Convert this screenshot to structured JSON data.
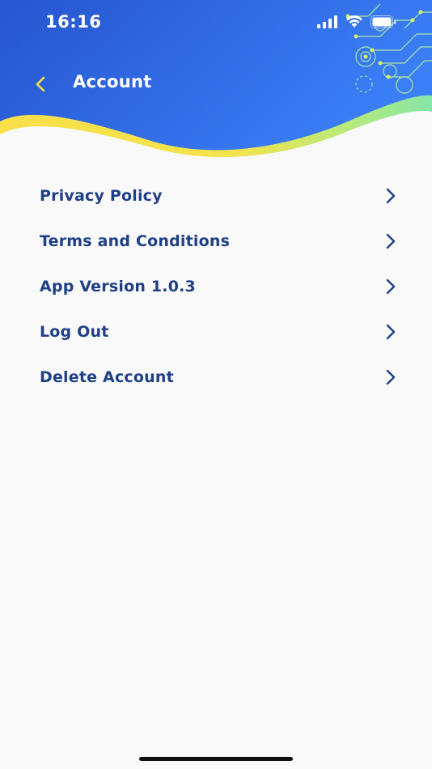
{
  "status_bar": {
    "time": "16:16"
  },
  "header": {
    "title": "Account",
    "back_icon": "chevron-left-icon",
    "gradient_start": "#2a5bd8",
    "gradient_end": "#3a7cf6",
    "wave_yellow": "#f7df4a",
    "wave_green": "#8ee6a2"
  },
  "menu": {
    "items": [
      {
        "label": "Privacy Policy",
        "icon": "chevron-right-icon"
      },
      {
        "label": "Terms and Conditions",
        "icon": "chevron-right-icon"
      },
      {
        "label": "App Version 1.0.3",
        "icon": "chevron-right-icon"
      },
      {
        "label": "Log Out",
        "icon": "chevron-right-icon"
      },
      {
        "label": "Delete Account",
        "icon": "chevron-right-icon"
      }
    ],
    "text_color": "#1f3f86"
  }
}
